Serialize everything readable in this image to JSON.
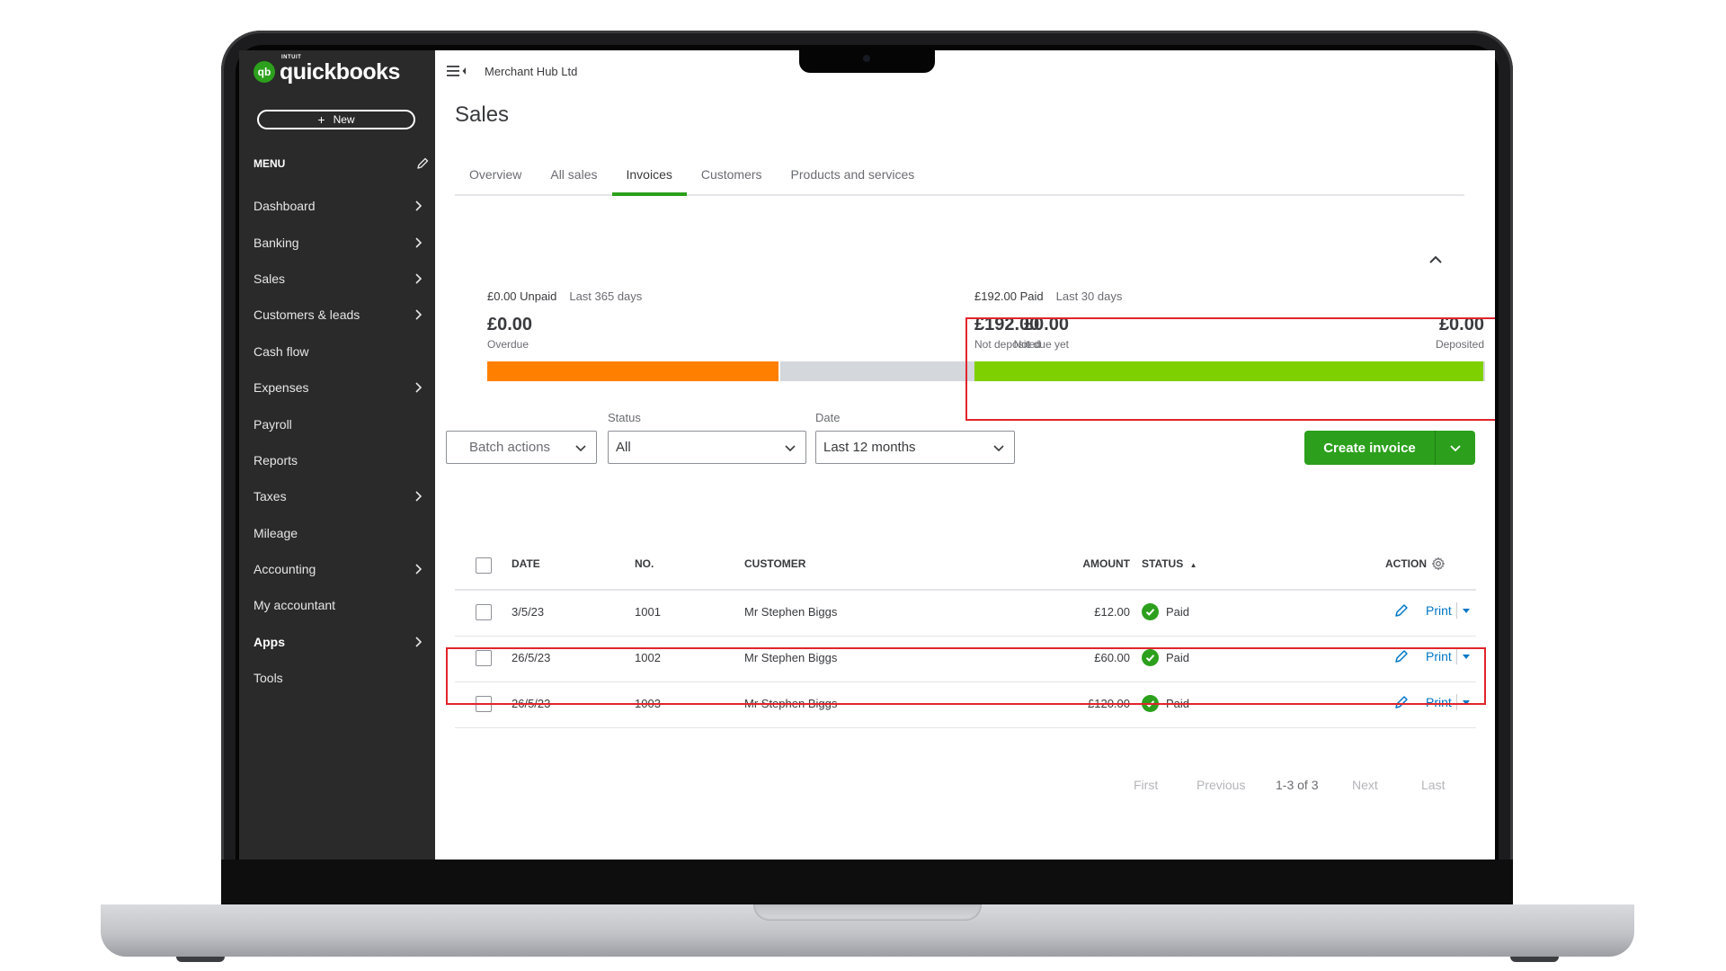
{
  "app": {
    "brand_small": "INTUIT",
    "brand_name": "quickbooks",
    "brand_logo": "qb",
    "company": "Merchant Hub Ltd"
  },
  "sidebar": {
    "new_label": "New",
    "menu_label": "MENU",
    "items": [
      {
        "label": "Dashboard",
        "chevron": true,
        "bold": false
      },
      {
        "label": "Banking",
        "chevron": true,
        "bold": false
      },
      {
        "label": "Sales",
        "chevron": true,
        "bold": false
      },
      {
        "label": "Customers & leads",
        "chevron": true,
        "bold": false
      },
      {
        "label": "Cash flow",
        "chevron": false,
        "bold": false
      },
      {
        "label": "Expenses",
        "chevron": true,
        "bold": false
      },
      {
        "label": "Payroll",
        "chevron": false,
        "bold": false
      },
      {
        "label": "Reports",
        "chevron": false,
        "bold": false
      },
      {
        "label": "Taxes",
        "chevron": true,
        "bold": false
      },
      {
        "label": "Mileage",
        "chevron": false,
        "bold": false
      },
      {
        "label": "Accounting",
        "chevron": true,
        "bold": false
      },
      {
        "label": "My accountant",
        "chevron": false,
        "bold": false
      },
      {
        "label": "Apps",
        "chevron": true,
        "bold": true
      },
      {
        "label": "Tools",
        "chevron": false,
        "bold": false
      }
    ]
  },
  "page": {
    "title": "Sales",
    "tabs": [
      "Overview",
      "All sales",
      "Invoices",
      "Customers",
      "Products and services"
    ],
    "active_tab": "Invoices"
  },
  "summary": {
    "unpaid": {
      "title": "£0.00 Unpaid",
      "period": "Last 365 days",
      "left_amount": "£0.00",
      "left_label": "Overdue",
      "right_amount": "£0.00",
      "right_label": "Not due yet",
      "bar_fill_fraction": 0.5,
      "bar_colors": [
        "#ff8000",
        "#d4d7dc"
      ]
    },
    "paid": {
      "title": "£192.00 Paid",
      "period": "Last 30 days",
      "left_amount": "£192.00",
      "left_label": "Not deposited",
      "right_amount": "£0.00",
      "right_label": "Deposited",
      "bar_fill_fraction": 1.0,
      "bar_colors": [
        "#7fd000",
        "#d4d7dc"
      ]
    }
  },
  "filters": {
    "batch_label": "Batch actions",
    "status_label": "Status",
    "status_value": "All",
    "date_label": "Date",
    "date_value": "Last 12 months"
  },
  "create_invoice_label": "Create invoice",
  "table": {
    "headers": {
      "date": "DATE",
      "no": "NO.",
      "customer": "CUSTOMER",
      "amount": "AMOUNT",
      "status": "STATUS",
      "action": "ACTION"
    },
    "rows": [
      {
        "date": "3/5/23",
        "no": "1001",
        "customer": "Mr Stephen Biggs",
        "amount": "£12.00",
        "status": "Paid",
        "action": "Print"
      },
      {
        "date": "26/5/23",
        "no": "1002",
        "customer": "Mr Stephen Biggs",
        "amount": "£60.00",
        "status": "Paid",
        "action": "Print"
      },
      {
        "date": "26/5/23",
        "no": "1003",
        "customer": "Mr Stephen Biggs",
        "amount": "£120.00",
        "status": "Paid",
        "action": "Print"
      }
    ]
  },
  "pagination": {
    "first": "First",
    "previous": "Previous",
    "count": "1-3 of 3",
    "next": "Next",
    "last": "Last"
  },
  "colors": {
    "brand_green": "#2ca01c",
    "link_blue": "#0077c5",
    "highlight_red": "#e1242b",
    "sidebar_bg": "#2a2a2a"
  }
}
